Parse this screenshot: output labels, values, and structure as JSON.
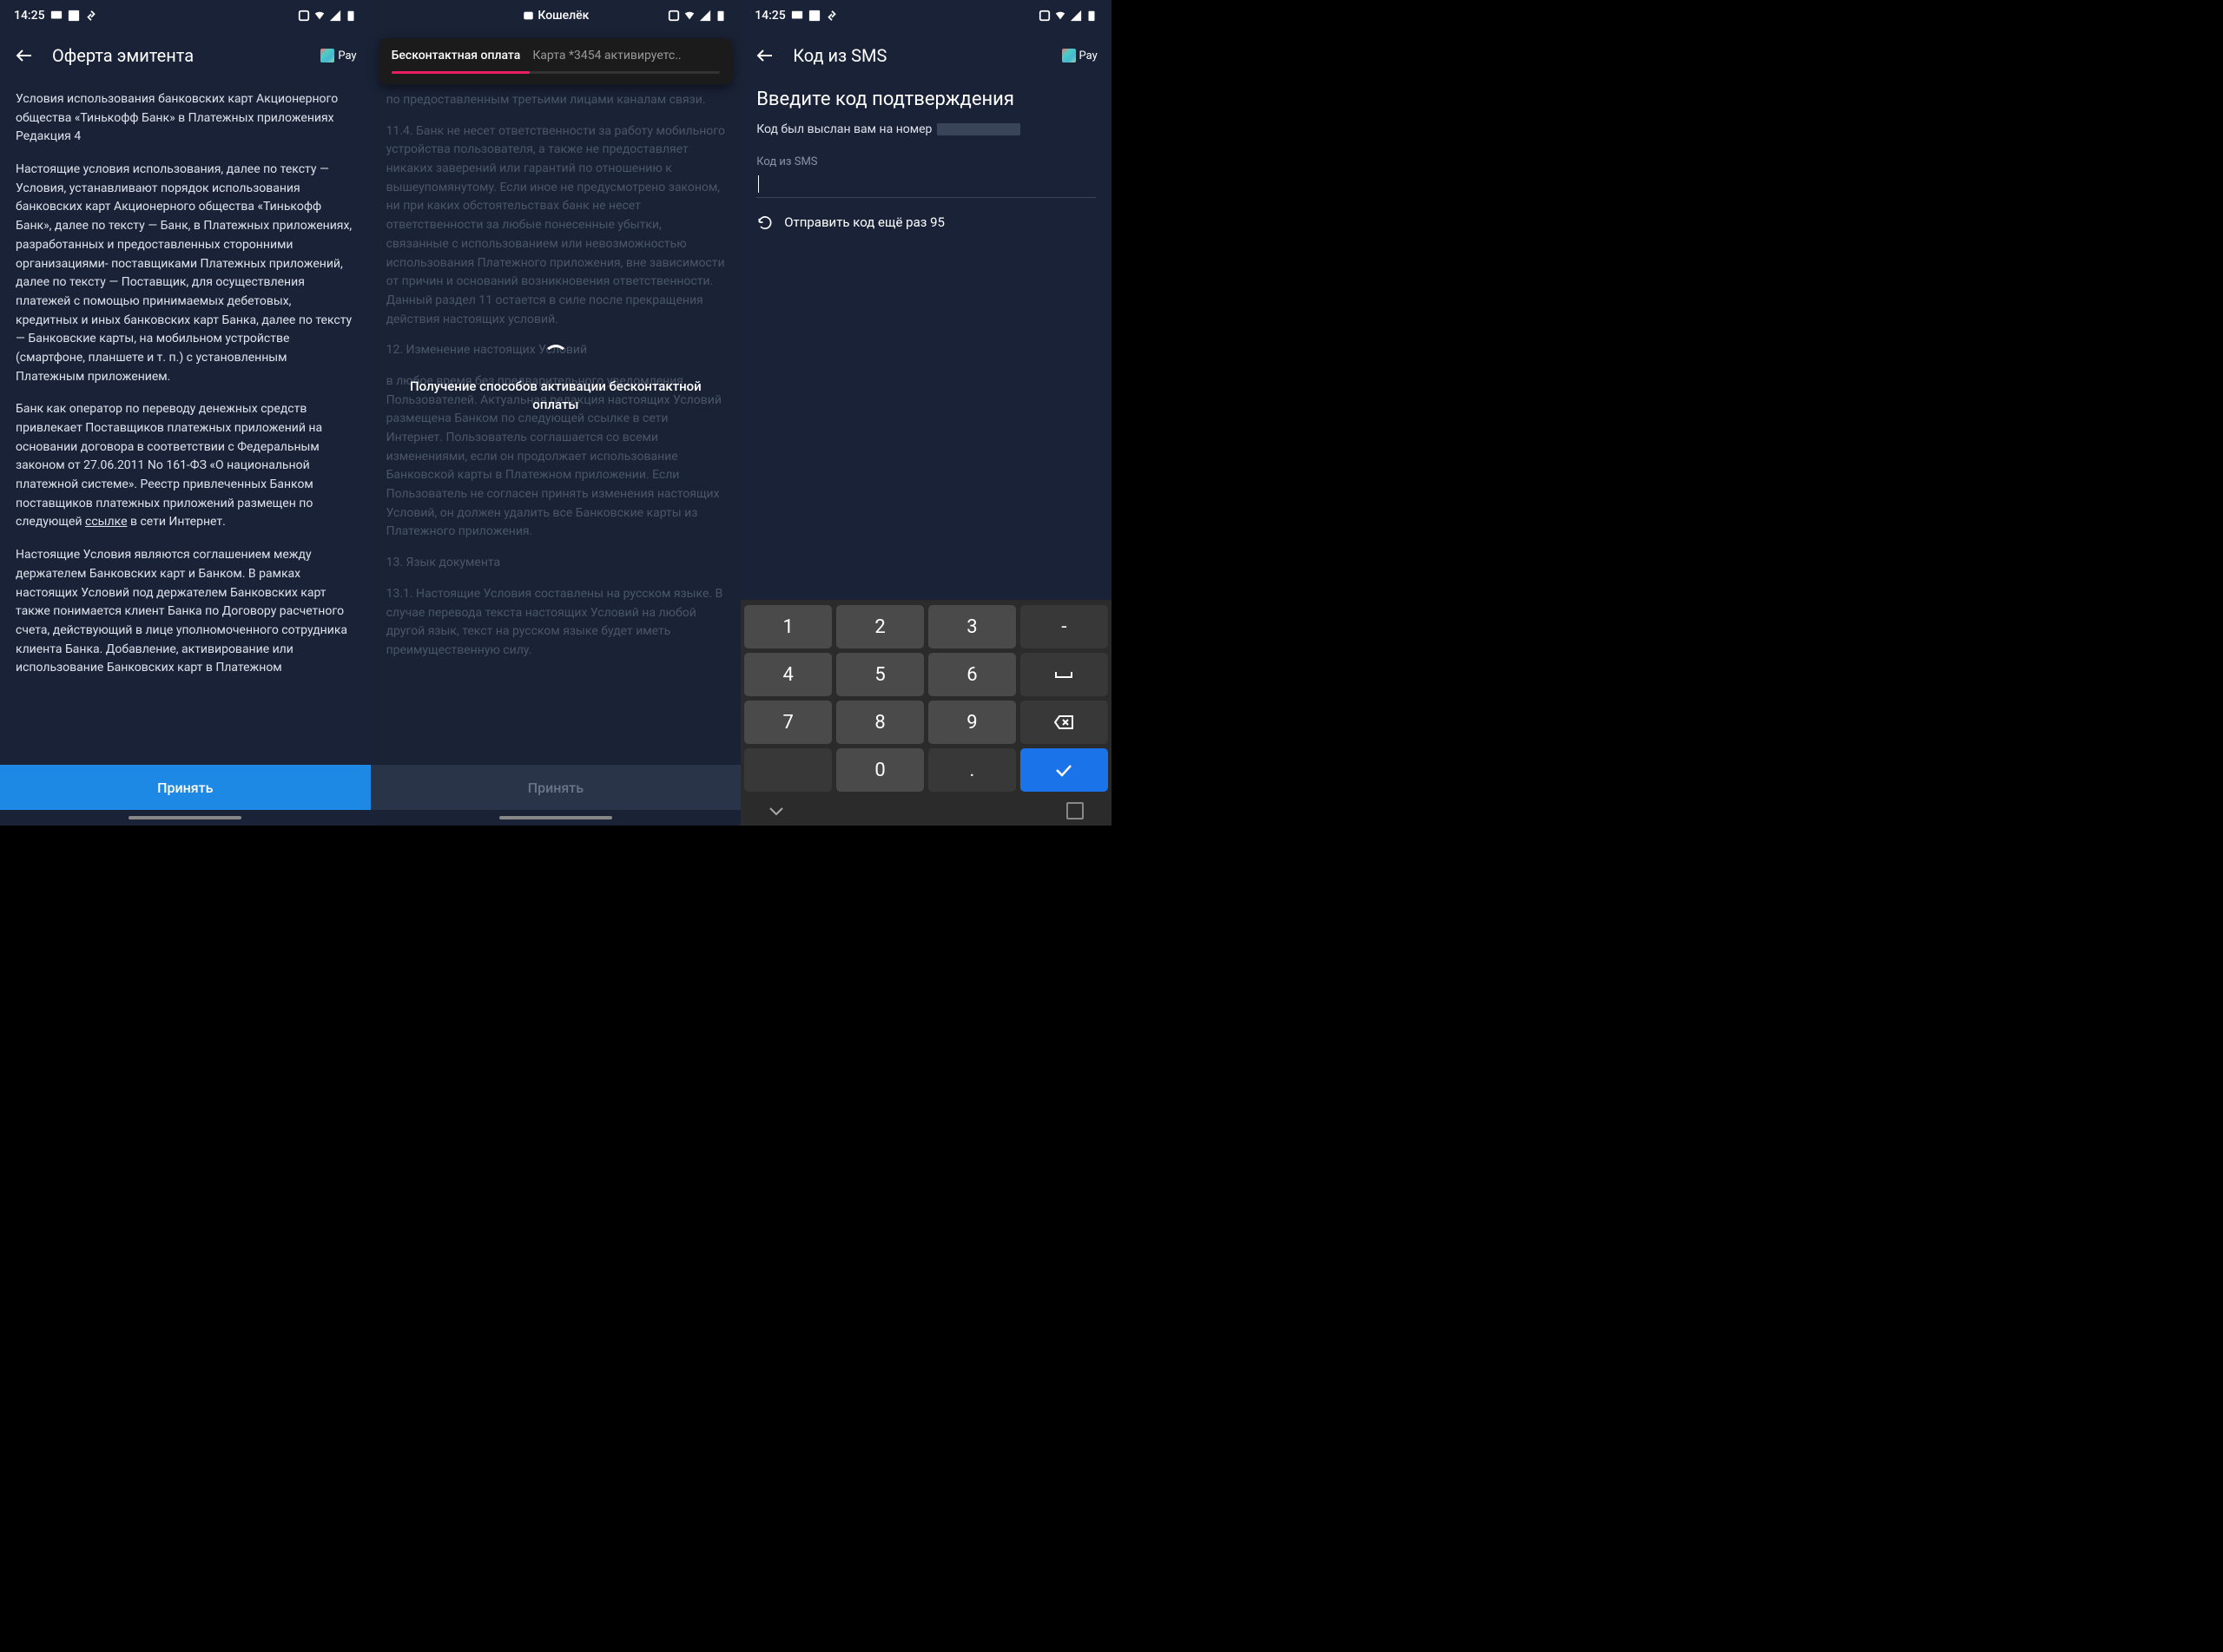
{
  "statusbar": {
    "time": "14:25",
    "walletLabel": "Кошелёк"
  },
  "screen1": {
    "title": "Оферта эмитента",
    "payLabel": "Pay",
    "p1": "Условия использования банковских карт Акционерного общества «Тинькофф Банк» в Платежных приложениях",
    "p1b": "Редакция 4",
    "p2": "Настоящие условия использования, далее по тексту — Условия, устанавливают порядок использования банковских карт Акционерного общества «Тинькофф Банк», далее по тексту — Банк, в Платежных приложениях, разработанных и предоставленных сторонними организациями- поставщиками Платежных приложений, далее по тексту — Поставщик, для осуществления платежей с помощью принимаемых дебетовых, кредитных и иных банковских карт Банка, далее по тексту — Банковские карты, на мобильном устройстве (смартфоне, планшете и т. п.) с установленным Платежным приложением.",
    "p3a": "Банк как оператор по переводу денежных средств привлекает Поставщиков платежных приложений на основании договора в соответствии с Федеральным законом от 27.06.2011 No 161-ФЗ «О национальной платежной системе». Реестр привлеченных Банком поставщиков платежных приложений размещен по следующей ",
    "p3link": "ссылке",
    "p3b": " в сети Интернет.",
    "p4": "Настоящие Условия являются соглашением между держателем Банковских карт и Банком. В рамках настоящих Условий под держателем Банковских карт также понимается клиент Банка по Договору расчетного счета, действующий в лице уполномоченного сотрудника клиента Банка. Добавление, активирование или использование Банковских карт в Платежном",
    "button": "Принять"
  },
  "screen2": {
    "toastTitle": "Бесконтактная оплата",
    "toastSub": "Карта *3454 активируетс..",
    "d1": "по предоставленным третьими лицами каналам связи.",
    "d2": "11.4. Банк не несет ответственности за работу мобильного устройства пользователя, а также не предоставляет никаких заверений или гарантий по отношению к вышеупомянутому. Если иное не предусмотрено законом, ни при каких обстоятельствах банк не несет ответственности за любые понесенные убытки, связанные с использованием или невозможностью использования Платежного приложения, вне зависимости от причин и оснований возникновения ответственности.",
    "d2b": "Данный раздел 11 остается в силе после прекращения действия настоящих условий.",
    "d3h": "12. Изменение настоящих Условий",
    "d3": "в любое время без предварительного уведомления Пользователей. Актуальная редакция настоящих Условий размещена Банком по следующей ссылке в сети Интернет. Пользователь соглашается со всеми изменениями, если он продолжает использование Банковской карты в Платежном приложении. Если Пользователь не согласен принять изменения настоящих Условий, он должен удалить все Банковские карты из Платежного приложения.",
    "d4h": "13. Язык документа",
    "d4": "13.1. Настоящие Условия составлены на русском языке. В случае перевода текста настоящих Условий на любой другой язык, текст на русском языке будет иметь преимущественную силу.",
    "overlayText": "Получение способов активации бесконтактной оплаты",
    "button": "Принять"
  },
  "screen3": {
    "title": "Код из SMS",
    "payLabel": "Pay",
    "heading": "Введите код подтверждения",
    "sub": "Код был выслан вам на номер",
    "inputLabel": "Код из SMS",
    "resend": "Отправить код ещё раз 95",
    "keypad": {
      "r1": [
        "1",
        "2",
        "3",
        "-"
      ],
      "r2": [
        "4",
        "5",
        "6",
        "␣"
      ],
      "r3": [
        "7",
        "8",
        "9",
        "⌫"
      ],
      "r4": [
        "",
        "0",
        ".",
        "✓"
      ]
    }
  }
}
